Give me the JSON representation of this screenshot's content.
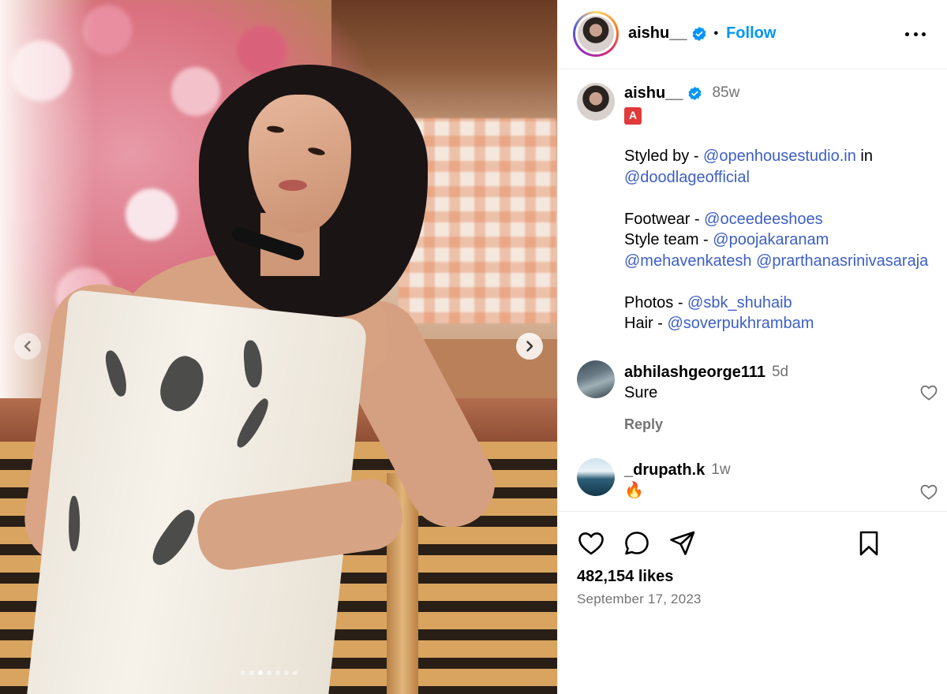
{
  "post": {
    "author": "aishu__",
    "follow_label": "Follow",
    "separator": "•",
    "media_slides": 7,
    "active_slide": 3
  },
  "caption": {
    "author": "aishu__",
    "time": "85w",
    "badge": "A",
    "line1_prefix": "Styled by - ",
    "line1_link": "@openhousestudio.in",
    "line1_suffix": " in",
    "line2_link": "@doodlageofficial",
    "footwear_prefix": "Footwear - ",
    "footwear_link": "@oceedeeshoes",
    "style_team_prefix": "Style team - ",
    "style_team_link1": "@poojakaranam",
    "style_team_link2": "@mehavenkatesh",
    "style_team_link3": "@prarthanasrinivasaraja",
    "photos_prefix": "Photos - ",
    "photos_link": "@sbk_shuhaib",
    "hair_prefix": "Hair - ",
    "hair_link": "@soverpukhrambam"
  },
  "comments": [
    {
      "user": "abhilashgeorge111",
      "time": "5d",
      "text": "Sure",
      "reply_label": "Reply"
    },
    {
      "user": "_drupath.k",
      "time": "1w",
      "text": "🔥"
    }
  ],
  "stats": {
    "likes": "482,154 likes",
    "date": "September 17, 2023"
  },
  "icons": {
    "verified": "verified-badge-icon",
    "more": "more-options-icon",
    "like": "heart-icon",
    "comment": "comment-bubble-icon",
    "share": "paper-plane-icon",
    "save": "bookmark-icon",
    "prev": "chevron-left-icon",
    "next": "chevron-right-icon"
  },
  "colors": {
    "follow": "#0095f6",
    "verified": "#0095f6",
    "link": "#3d5fc4",
    "muted": "#737373"
  }
}
